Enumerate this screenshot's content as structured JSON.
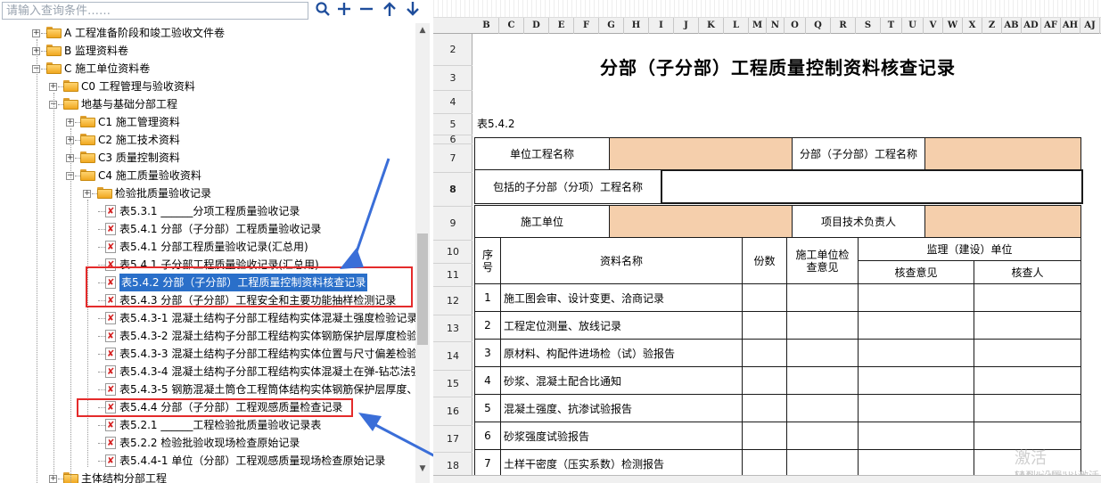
{
  "search": {
    "placeholder": "请输入查询条件……",
    "icons": [
      "search-icon",
      "plus-icon",
      "minus-icon",
      "arrow-up-icon",
      "arrow-down-icon"
    ]
  },
  "tree": {
    "items": [
      {
        "label": "A 工程准备阶段和竣工验收文件卷",
        "type": "folder",
        "expander": "+"
      },
      {
        "label": "B 监理资料卷",
        "type": "folder",
        "expander": "+"
      },
      {
        "label": "C 施工单位资料卷",
        "type": "folder",
        "expander": "−"
      },
      {
        "label": "C0 工程管理与验收资料",
        "type": "folder",
        "expander": "+"
      },
      {
        "label": "地基与基础分部工程",
        "type": "folder",
        "expander": "−"
      },
      {
        "label": "C1 施工管理资料",
        "type": "folder",
        "expander": "+"
      },
      {
        "label": "C2 施工技术资料",
        "type": "folder",
        "expander": "+"
      },
      {
        "label": "C3 质量控制资料",
        "type": "folder",
        "expander": "+"
      },
      {
        "label": "C4 施工质量验收资料",
        "type": "folder",
        "expander": "−"
      },
      {
        "label": "检验批质量验收记录",
        "type": "folder",
        "expander": "+"
      },
      {
        "label": "表5.3.1 ______分项工程质量验收记录",
        "type": "doc"
      },
      {
        "label": "表5.4.1 分部（子分部）工程质量验收记录",
        "type": "doc"
      },
      {
        "label": "表5.4.1 分部工程质量验收记录(汇总用)",
        "type": "doc"
      },
      {
        "label": "表5.4.1 子分部工程质量验收记录(汇总用)",
        "type": "doc"
      },
      {
        "label": "表5.4.2 分部（子分部）工程质量控制资料核查记录",
        "type": "doc",
        "selected": true
      },
      {
        "label": "表5.4.3 分部（子分部）工程安全和主要功能抽样检测记录",
        "type": "doc"
      },
      {
        "label": "表5.4.3-1 混凝土结构子分部工程结构实体混凝土强度检验记录",
        "type": "doc"
      },
      {
        "label": "表5.4.3-2 混凝土结构子分部工程结构实体钢筋保护层厚度检验",
        "type": "doc"
      },
      {
        "label": "表5.4.3-3 混凝土结构子分部工程结构实体位置与尺寸偏差检验",
        "type": "doc"
      },
      {
        "label": "表5.4.3-4 混凝土结构子分部工程结构实体混凝土在弹-钻芯法强",
        "type": "doc"
      },
      {
        "label": "表5.4.3-5 钢筋混凝土筒仓工程筒体结构实体钢筋保护层厚度、",
        "type": "doc"
      },
      {
        "label": "表5.4.4 分部（子分部）工程观感质量检查记录",
        "type": "doc"
      },
      {
        "label": "表5.2.1 ______工程检验批质量验收记录表",
        "type": "doc"
      },
      {
        "label": "表5.2.2 检验批验收现场检查原始记录",
        "type": "doc"
      },
      {
        "label": "表5.4.4-1 单位（分部）工程观感质量现场检查原始记录",
        "type": "doc"
      },
      {
        "label": "主体结构分部工程",
        "type": "folder",
        "expander": "+"
      }
    ]
  },
  "sheet": {
    "columns": [
      "B",
      "C",
      "D",
      "E",
      "F",
      "G",
      "H",
      "I",
      "J",
      "K",
      "L",
      "M",
      "N",
      "O",
      "Q",
      "R",
      "S",
      "T",
      "U",
      "V",
      "W",
      "X",
      "Z",
      "AB",
      "AD",
      "AF",
      "AH",
      "AJ"
    ],
    "rows": [
      "2",
      "3",
      "4",
      "5",
      "6",
      "7",
      "8",
      "9",
      "10",
      "11",
      "12",
      "13",
      "14",
      "15",
      "16",
      "17",
      "18"
    ],
    "title": "分部（子分部）工程质量控制资料核查记录",
    "table_no": "表5.4.2",
    "unit_project_label": "单位工程名称",
    "sub_project_label": "分部（子分部）工程名称",
    "included_label": "包括的子分部（分项）工程名称",
    "constructor_label": "施工单位",
    "tech_lead_label": "项目技术负责人",
    "col_seq": "序号",
    "col_name": "资料名称",
    "col_copies": "份数",
    "col_constructor_check": "施工单位检查意见",
    "col_supervision": "监理（建设）单位",
    "col_check_opinion": "核查意见",
    "col_checker": "核查人",
    "items": [
      {
        "no": "1",
        "name": "施工图会审、设计变更、洽商记录"
      },
      {
        "no": "2",
        "name": "工程定位测量、放线记录"
      },
      {
        "no": "3",
        "name": "原材料、构配件进场检（试）验报告"
      },
      {
        "no": "4",
        "name": "砂浆、混凝土配合比通知"
      },
      {
        "no": "5",
        "name": "混凝土强度、抗渗试验报告"
      },
      {
        "no": "6",
        "name": "砂浆强度试验报告"
      },
      {
        "no": "7",
        "name": "土样干密度（压实系数）检测报告"
      }
    ],
    "colors": {
      "orange_cell": "#f5cfac",
      "selection": "#2a6fc9",
      "annotation_red": "#e42b2b",
      "annotation_blue": "#3a6ed8"
    }
  },
  "watermark": {
    "line1": "激活 Windows",
    "line2": "转到\"设置\"以激活 Win"
  }
}
